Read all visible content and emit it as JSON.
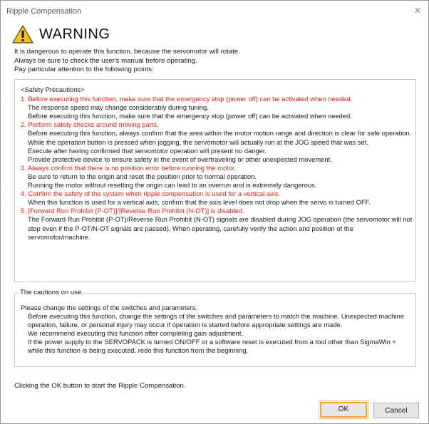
{
  "window": {
    "title": "Ripple Compensation",
    "close_glyph": "✕"
  },
  "warning": {
    "heading": "WARNING",
    "icon": "warning-triangle-icon",
    "intro_lines": [
      "It is dangerous to operate this function, because the servomotor will rotate.",
      "Always be sure to check the user's manual before operating.",
      "Pay particular attention to the following points:"
    ]
  },
  "precautions": {
    "header": "<Safety Precautions>",
    "items": [
      {
        "title": "1. Before executing this function, make sure that the emergency stop (power off) can be activated when needed.",
        "lines": [
          "The response speed may change considerably during tuning.",
          "Before executing this function, make sure that the emergency stop (power off) can be activated when needed."
        ]
      },
      {
        "title": "2. Perform safety checks around moving parts.",
        "lines": [
          "Before executing this function, always confirm that the area within the motor motion range and direction is clear for safe operation.",
          "While the operation button is pressed when jogging, the servomotor will actually run at the JOG speed that was set.",
          "Execute after having confirmed that servomotor operation will present no danger.",
          "Provide protective device to ensure safety in the event of overtraveling or other unexpected movement."
        ]
      },
      {
        "title": "3. Always confirm that there is no position error before running the motor.",
        "lines": [
          "Be sure to return to the origin and reset the position prior to normal operation.",
          "Running the motor without resetting the origin can lead to an overrun and is extremely dangerous."
        ]
      },
      {
        "title": "4. Confirm the safety of the system when ripple compensation is used for a vertical axis.",
        "lines": [
          "When this function is used for a vertical axis, confirm that the axis level does not drop when the servo is turned OFF."
        ]
      },
      {
        "title": "5. [Forward Run Prohibit (P-OT)]/[Reverse Run Prohibit (N-OT)] is disabled.",
        "lines": [
          "The Forward Run Prohibit (P-OT)/Reverse Run Prohibit (N-OT) signals are disabled during JOG operation (the servomotor will not stop even if the P-OT/N-OT signals are passed). When operating, carefully verify the action and position of the servomotor/machine."
        ]
      }
    ]
  },
  "cautions": {
    "legend": "The cautions on use",
    "lead": "Please change the settings of the switches and parameters.",
    "lines": [
      "Before executing this function, change the settings of the switches and parameters to match the machine. Unexpected machine operation, failure, or personal injury may occur if operation is started before appropriate settings are made.",
      "We recommend executing this function after completing gain adjustment.",
      "If the power supply to the SERVOPACK is turned ON/OFF or a software reset is executed from a tool other than SigmaWin + while this function is being executed, redo this function from the beginning."
    ]
  },
  "footer": {
    "instruction": "Clicking the OK button to start the Ripple Compensation.",
    "ok_label": "OK",
    "cancel_label": "Cancel"
  },
  "colors": {
    "accent_red": "#e0241a",
    "focus_orange": "#f0a43a"
  }
}
